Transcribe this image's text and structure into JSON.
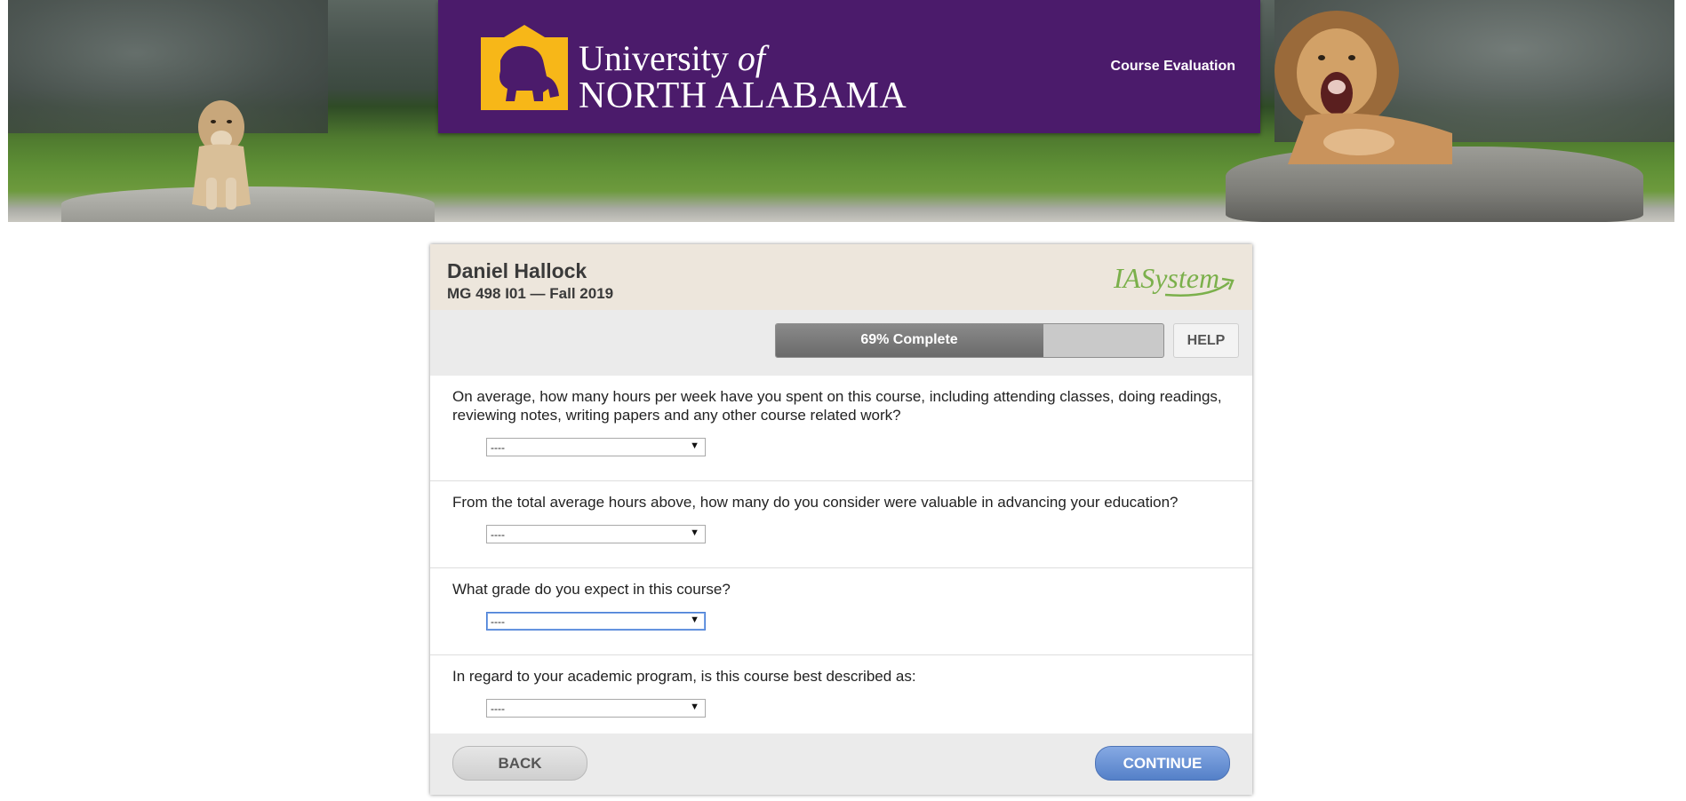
{
  "banner": {
    "university_line1_main": "University ",
    "university_line1_of": "of",
    "university_line2": "NORTH ALABAMA",
    "app_title": "Course Evaluation",
    "brand_purple": "#4b1b6b",
    "brand_gold": "#f7b718"
  },
  "header": {
    "instructor": "Daniel Hallock",
    "course": "MG 498 I01 — Fall 2019",
    "logo_text": "IASystem",
    "logo_color": "#7bb04b"
  },
  "progress": {
    "label": "69% Complete",
    "percent": 69,
    "help_label": "HELP"
  },
  "questions": [
    {
      "text": "On average, how many hours per week have you spent on this course, including attending classes, doing readings, reviewing notes, writing papers and any other course related work?",
      "selected": "----"
    },
    {
      "text": "From the total average hours above, how many do you consider were valuable in advancing your education?",
      "selected": "----"
    },
    {
      "text": "What grade do you expect in this course?",
      "selected": "----"
    },
    {
      "text": "In regard to your academic program, is this course best described as:",
      "selected": "----"
    }
  ],
  "footer": {
    "back_label": "BACK",
    "continue_label": "CONTINUE"
  }
}
